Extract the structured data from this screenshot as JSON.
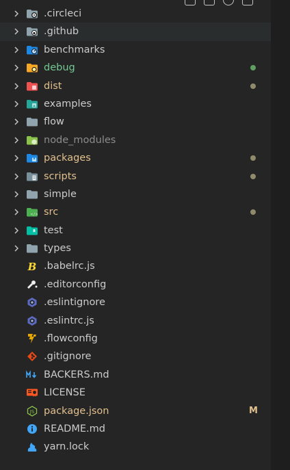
{
  "colors": {
    "modified": "#e2c08d",
    "untracked": "#73c991",
    "ignored": "#8c8c8c",
    "deco_dot": "#8f8a6a",
    "deco_dot_green": "#5f9f5f"
  },
  "tree": [
    {
      "label": ".circleci",
      "kind": "folder",
      "icon": "folder-circleci-icon"
    },
    {
      "label": ".github",
      "kind": "folder",
      "icon": "folder-github-icon",
      "hover": true
    },
    {
      "label": "benchmarks",
      "kind": "folder",
      "icon": "folder-benchmark-icon"
    },
    {
      "label": "debug",
      "kind": "folder",
      "icon": "folder-debug-icon",
      "status": "untracked",
      "deco": "dot"
    },
    {
      "label": "dist",
      "kind": "folder",
      "icon": "folder-dist-icon",
      "status": "modified",
      "deco": "dot"
    },
    {
      "label": "examples",
      "kind": "folder",
      "icon": "folder-examples-icon"
    },
    {
      "label": "flow",
      "kind": "folder",
      "icon": "folder-icon"
    },
    {
      "label": "node_modules",
      "kind": "folder",
      "icon": "folder-node-icon",
      "status": "ignored"
    },
    {
      "label": "packages",
      "kind": "folder",
      "icon": "folder-packages-icon",
      "status": "modified",
      "deco": "dot"
    },
    {
      "label": "scripts",
      "kind": "folder",
      "icon": "folder-scripts-icon",
      "status": "modified",
      "deco": "dot"
    },
    {
      "label": "simple",
      "kind": "folder",
      "icon": "folder-icon"
    },
    {
      "label": "src",
      "kind": "folder",
      "icon": "folder-src-icon",
      "status": "modified",
      "deco": "dot"
    },
    {
      "label": "test",
      "kind": "folder",
      "icon": "folder-test-icon"
    },
    {
      "label": "types",
      "kind": "folder",
      "icon": "folder-icon"
    },
    {
      "label": ".babelrc.js",
      "kind": "file",
      "icon": "babel-icon"
    },
    {
      "label": ".editorconfig",
      "kind": "file",
      "icon": "editorconfig-icon"
    },
    {
      "label": ".eslintignore",
      "kind": "file",
      "icon": "eslint-icon"
    },
    {
      "label": ".eslintrc.js",
      "kind": "file",
      "icon": "eslint-icon"
    },
    {
      "label": ".flowconfig",
      "kind": "file",
      "icon": "flow-icon"
    },
    {
      "label": ".gitignore",
      "kind": "file",
      "icon": "git-icon"
    },
    {
      "label": "BACKERS.md",
      "kind": "file",
      "icon": "markdown-icon"
    },
    {
      "label": "LICENSE",
      "kind": "file",
      "icon": "license-icon"
    },
    {
      "label": "package.json",
      "kind": "file",
      "icon": "nodejs-icon",
      "status": "modified",
      "deco": "letter",
      "deco_text": "M"
    },
    {
      "label": "README.md",
      "kind": "file",
      "icon": "info-icon"
    },
    {
      "label": "yarn.lock",
      "kind": "file",
      "icon": "yarn-icon"
    }
  ]
}
